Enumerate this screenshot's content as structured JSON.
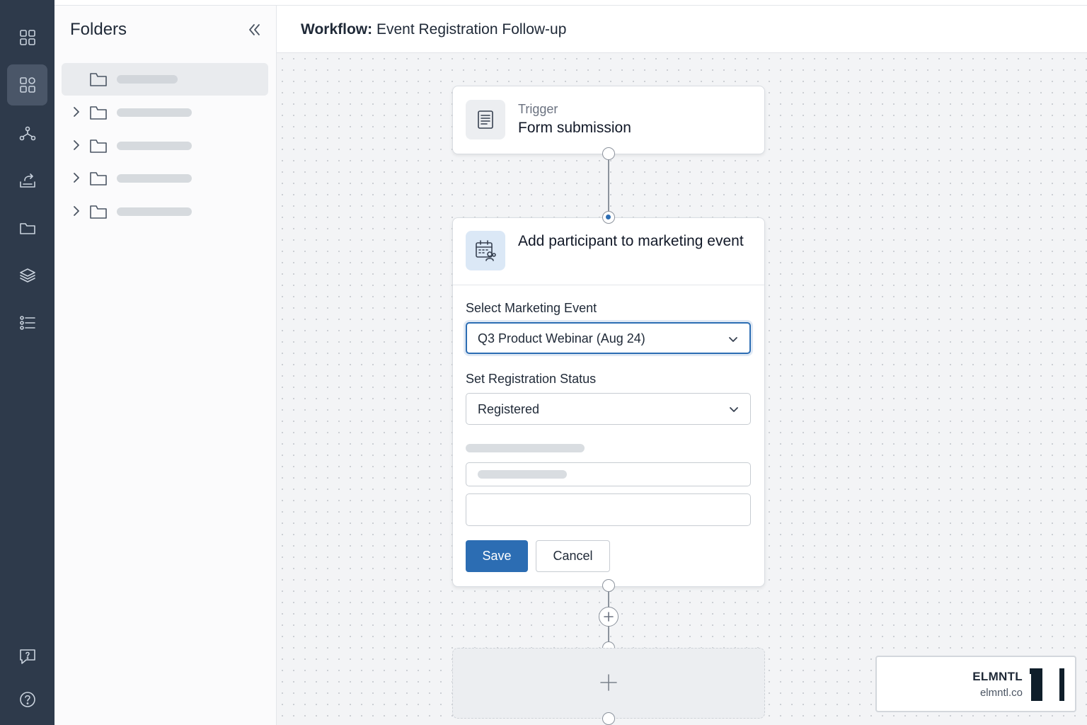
{
  "header": {
    "title_prefix": "Workflow:",
    "title": "Event Registration Follow-up"
  },
  "rail": {
    "items": [
      {
        "icon": "grid-icon",
        "active": false
      },
      {
        "icon": "apps-icon",
        "active": true
      },
      {
        "icon": "workflow-icon",
        "active": false
      },
      {
        "icon": "upload-tray-icon",
        "active": false
      },
      {
        "icon": "folder-icon",
        "active": false
      },
      {
        "icon": "layers-icon",
        "active": false
      },
      {
        "icon": "checklist-icon",
        "active": false
      }
    ],
    "bottom": [
      {
        "icon": "feedback-icon"
      },
      {
        "icon": "help-icon"
      }
    ]
  },
  "folders": {
    "title": "Folders",
    "items": [
      {
        "selected": true,
        "expandable": false
      },
      {
        "selected": false,
        "expandable": true
      },
      {
        "selected": false,
        "expandable": true
      },
      {
        "selected": false,
        "expandable": true
      },
      {
        "selected": false,
        "expandable": true
      }
    ]
  },
  "trigger": {
    "kicker": "Trigger",
    "title": "Form submission"
  },
  "action": {
    "title": "Add participant to marketing event",
    "event_label": "Select Marketing Event",
    "event_value": "Q3 Product Webinar (Aug 24)",
    "status_label": "Set Registration Status",
    "status_value": "Registered",
    "save_label": "Save",
    "cancel_label": "Cancel"
  },
  "badge": {
    "name": "ELMNTL",
    "url": "elmntl.co"
  },
  "colors": {
    "accent": "#2c6db3",
    "rail": "#2e3a4b"
  }
}
